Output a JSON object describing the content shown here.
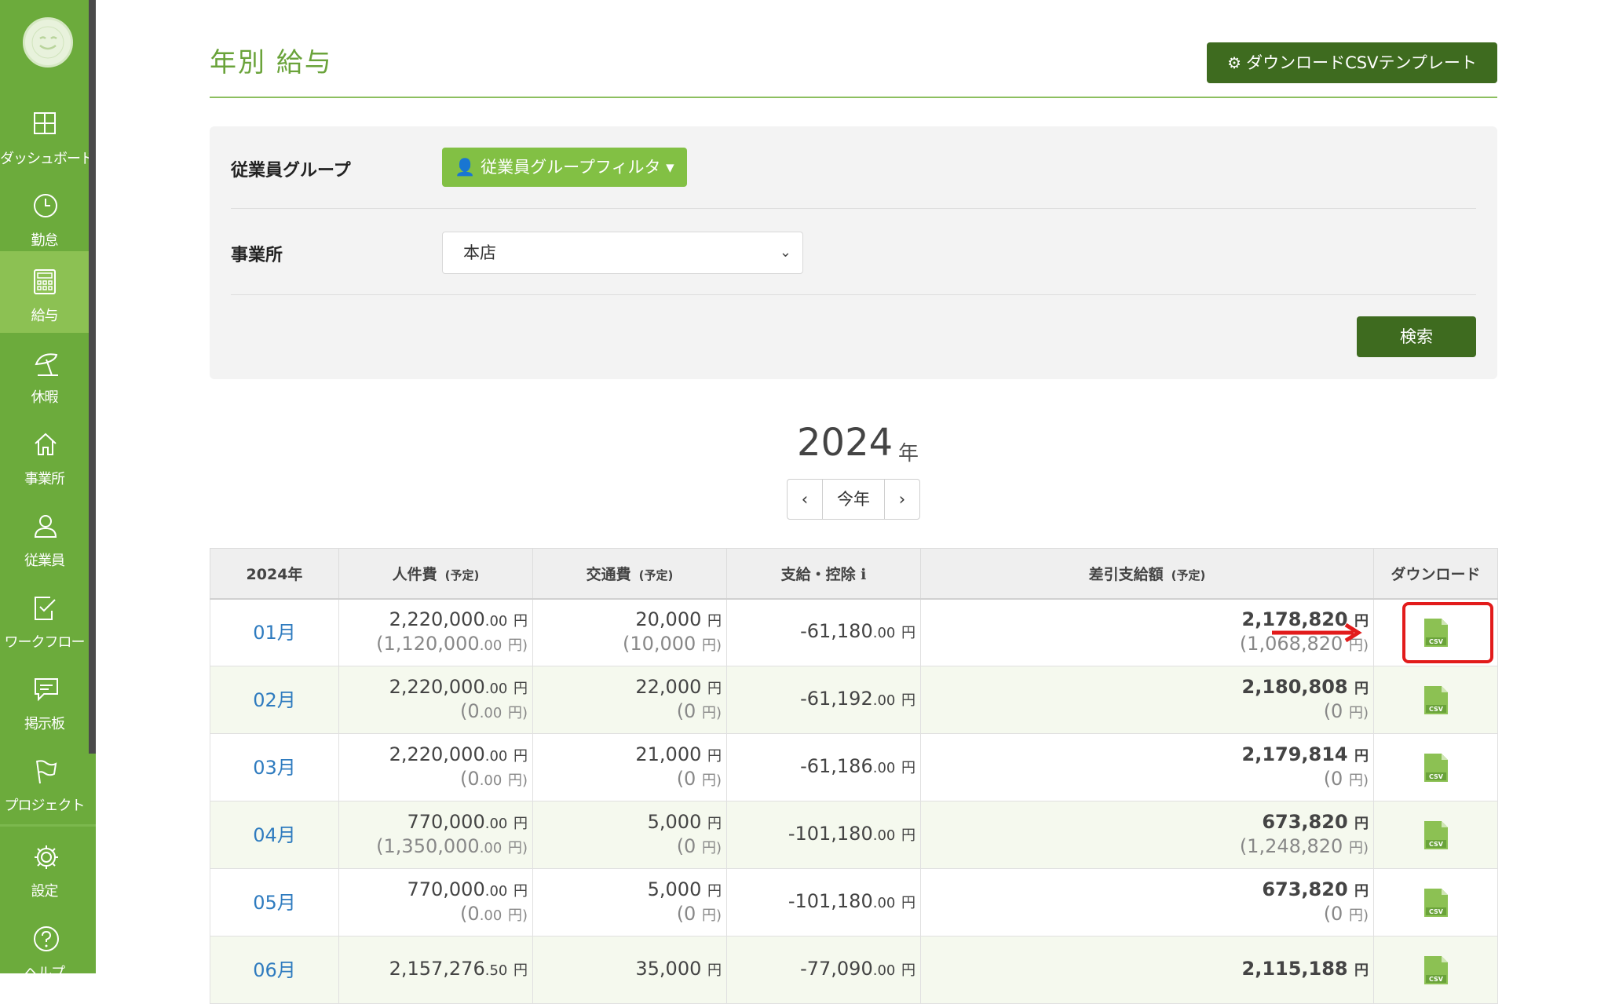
{
  "sidebar": {
    "items": [
      {
        "label": "ダッシュボード",
        "icon": "dashboard-icon"
      },
      {
        "label": "勤怠",
        "icon": "clock-icon"
      },
      {
        "label": "給与",
        "icon": "calculator-icon",
        "active": true
      },
      {
        "label": "休暇",
        "icon": "beach-umbrella-icon"
      },
      {
        "label": "事業所",
        "icon": "home-icon"
      },
      {
        "label": "従業員",
        "icon": "person-icon"
      },
      {
        "label": "ワークフロー",
        "icon": "checklist-icon"
      },
      {
        "label": "掲示板",
        "icon": "chat-icon"
      },
      {
        "label": "プロジェクト",
        "icon": "flag-icon"
      }
    ],
    "settings_label": "設定",
    "help_label": "ヘルプ"
  },
  "header": {
    "title": "年別 給与",
    "csv_template_button": "ダウンロードCSVテンプレート"
  },
  "filter": {
    "group_label": "従業員グループ",
    "group_button": "従業員グループフィルタ",
    "office_label": "事業所",
    "office_value": "本店",
    "search_button": "検索"
  },
  "year_nav": {
    "year": "2024",
    "unit": "年",
    "prev": "‹",
    "current": "今年",
    "next": "›"
  },
  "table": {
    "headers": {
      "year": "2024年",
      "labor": "人件費",
      "labor_note": "(予定)",
      "transport": "交通費",
      "transport_note": "(予定)",
      "payment": "支給・控除",
      "net": "差引支給額",
      "net_note": "(予定)",
      "download": "ダウンロード"
    },
    "rows": [
      {
        "month": "01月",
        "labor": "2,220,000",
        "labor_dec": ".00",
        "labor_plan": "(1,120,000",
        "labor_plan_dec": ".00",
        "transport": "20,000",
        "transport_plan": "(10,000",
        "payment": "-61,180",
        "payment_dec": ".00",
        "net": "2,178,820",
        "net_plan": "(1,068,820"
      },
      {
        "month": "02月",
        "labor": "2,220,000",
        "labor_dec": ".00",
        "labor_plan": "(0",
        "labor_plan_dec": ".00",
        "transport": "22,000",
        "transport_plan": "(0",
        "payment": "-61,192",
        "payment_dec": ".00",
        "net": "2,180,808",
        "net_plan": "(0"
      },
      {
        "month": "03月",
        "labor": "2,220,000",
        "labor_dec": ".00",
        "labor_plan": "(0",
        "labor_plan_dec": ".00",
        "transport": "21,000",
        "transport_plan": "(0",
        "payment": "-61,186",
        "payment_dec": ".00",
        "net": "2,179,814",
        "net_plan": "(0"
      },
      {
        "month": "04月",
        "labor": "770,000",
        "labor_dec": ".00",
        "labor_plan": "(1,350,000",
        "labor_plan_dec": ".00",
        "transport": "5,000",
        "transport_plan": "(0",
        "payment": "-101,180",
        "payment_dec": ".00",
        "net": "673,820",
        "net_plan": "(1,248,820"
      },
      {
        "month": "05月",
        "labor": "770,000",
        "labor_dec": ".00",
        "labor_plan": "(0",
        "labor_plan_dec": ".00",
        "transport": "5,000",
        "transport_plan": "(0",
        "payment": "-101,180",
        "payment_dec": ".00",
        "net": "673,820",
        "net_plan": "(0"
      },
      {
        "month": "06月",
        "labor": "2,157,276",
        "labor_dec": ".50",
        "labor_plan": "",
        "labor_plan_dec": "",
        "transport": "35,000",
        "transport_plan": "",
        "payment": "-77,090",
        "payment_dec": ".00",
        "net": "2,115,188",
        "net_plan": ""
      }
    ],
    "yen": "円",
    "yen_close": "円)",
    "csv_label": "CSV"
  },
  "colors": {
    "sidebar": "#6cab3c",
    "accent_dark": "#3e6b1f",
    "link": "#2e7bbf",
    "highlight": "#e21b1b"
  }
}
